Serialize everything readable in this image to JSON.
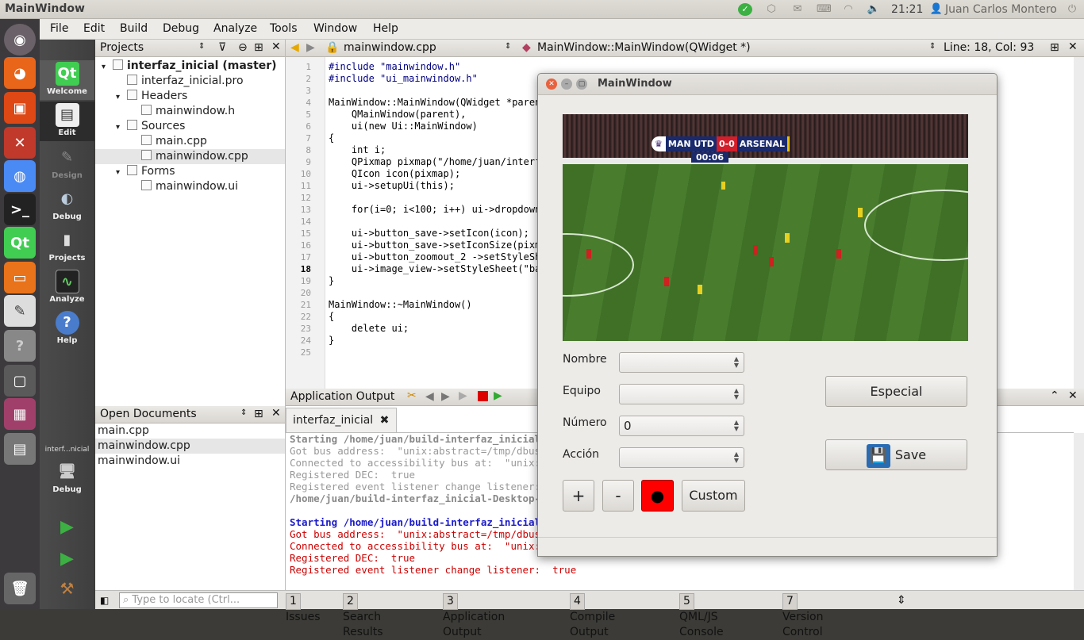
{
  "top_panel": {
    "title": "MainWindow",
    "clock": "21:21",
    "user": "Juan Carlos Montero"
  },
  "menubar": [
    "File",
    "Edit",
    "Build",
    "Debug",
    "Analyze",
    "Tools",
    "Window",
    "Help"
  ],
  "modes": [
    {
      "label": "Welcome",
      "icon": "qt-icon"
    },
    {
      "label": "Edit",
      "icon": "edit-icon"
    },
    {
      "label": "Design",
      "icon": "design-icon"
    },
    {
      "label": "Debug",
      "icon": "debug-icon"
    },
    {
      "label": "Projects",
      "icon": "projects-icon"
    },
    {
      "label": "Analyze",
      "icon": "analyze-icon"
    },
    {
      "label": "Help",
      "icon": "help-icon"
    }
  ],
  "kit": {
    "project": "interf...nicial",
    "label": "Debug"
  },
  "projects": {
    "header": "Projects",
    "tree": [
      {
        "text": "interfaz_inicial (master)",
        "level": 0,
        "bold": true,
        "arrow": "▾"
      },
      {
        "text": "interfaz_inicial.pro",
        "level": 1,
        "arrow": ""
      },
      {
        "text": "Headers",
        "level": 1,
        "arrow": "▾"
      },
      {
        "text": "mainwindow.h",
        "level": 2,
        "arrow": ""
      },
      {
        "text": "Sources",
        "level": 1,
        "arrow": "▾"
      },
      {
        "text": "main.cpp",
        "level": 2,
        "arrow": ""
      },
      {
        "text": "mainwindow.cpp",
        "level": 2,
        "arrow": "",
        "selected": true
      },
      {
        "text": "Forms",
        "level": 1,
        "arrow": "▾"
      },
      {
        "text": "mainwindow.ui",
        "level": 2,
        "arrow": ""
      }
    ]
  },
  "open_documents": {
    "header": "Open Documents",
    "items": [
      "main.cpp",
      "mainwindow.cpp",
      "mainwindow.ui"
    ]
  },
  "editor": {
    "file": "mainwindow.cpp",
    "symbol": "MainWindow::MainWindow(QWidget *)",
    "position": "Line: 18, Col: 93",
    "lines": [
      "#include \"mainwindow.h\"",
      "#include \"ui_mainwindow.h\"",
      "",
      "MainWindow::MainWindow(QWidget *paren",
      "    QMainWindow(parent),",
      "    ui(new Ui::MainWindow)",
      "{",
      "    int i;",
      "    QPixmap pixmap(\"/home/juan/interf",
      "    QIcon icon(pixmap);",
      "    ui->setupUi(this);",
      "",
      "    for(i=0; i<100; i++) ui->dropdown",
      "",
      "    ui->button_save->setIcon(icon);",
      "    ui->button_save->setIconSize(pixm",
      "    ui->button_zoomout_2 ->setStyleSh",
      "    ui->image_view->setStyleSheet(\"ba",
      "}",
      "",
      "MainWindow::~MainWindow()",
      "{",
      "    delete ui;",
      "}",
      ""
    ]
  },
  "output": {
    "header": "Application Output",
    "tab": "interfaz_inicial",
    "old_lines": [
      "Starting /home/juan/build-interfaz_inicial-D",
      "Got bus address:  \"unix:abstract=/tmp/dbus-",
      "Connected to accessibility bus at:  \"unix:ab",
      "Registered DEC:  true",
      "Registered event listener change listener:  ",
      "/home/juan/build-interfaz_inicial-Desktop-De"
    ],
    "new_lines": [
      "Starting /home/juan/build-interfaz_inicial-D",
      "Got bus address:  \"unix:abstract=/tmp/dbus-",
      "Connected to accessibility bus at:  \"unix:ab",
      "Registered DEC:  true",
      "Registered event listener change listener:  true"
    ]
  },
  "statusbar": {
    "locate_placeholder": "Type to locate (Ctrl...",
    "tabs": [
      {
        "n": "1",
        "label": "Issues"
      },
      {
        "n": "2",
        "label": "Search Results"
      },
      {
        "n": "3",
        "label": "Application Output"
      },
      {
        "n": "4",
        "label": "Compile Output"
      },
      {
        "n": "5",
        "label": "QML/JS Console"
      },
      {
        "n": "7",
        "label": "Version Control"
      }
    ]
  },
  "app_window": {
    "title": "MainWindow",
    "video": {
      "home": "MAN UTD",
      "score": "0-0",
      "away": "ARSENAL",
      "time": "00:06"
    },
    "labels": {
      "nombre": "Nombre",
      "equipo": "Equipo",
      "numero": "Número",
      "accion": "Acción"
    },
    "numero_value": "0",
    "buttons": {
      "especial": "Especial",
      "save": "Save",
      "plus": "+",
      "minus": "-",
      "record": "●",
      "custom": "Custom"
    },
    "colors": {
      "record": "#ff0000"
    }
  }
}
